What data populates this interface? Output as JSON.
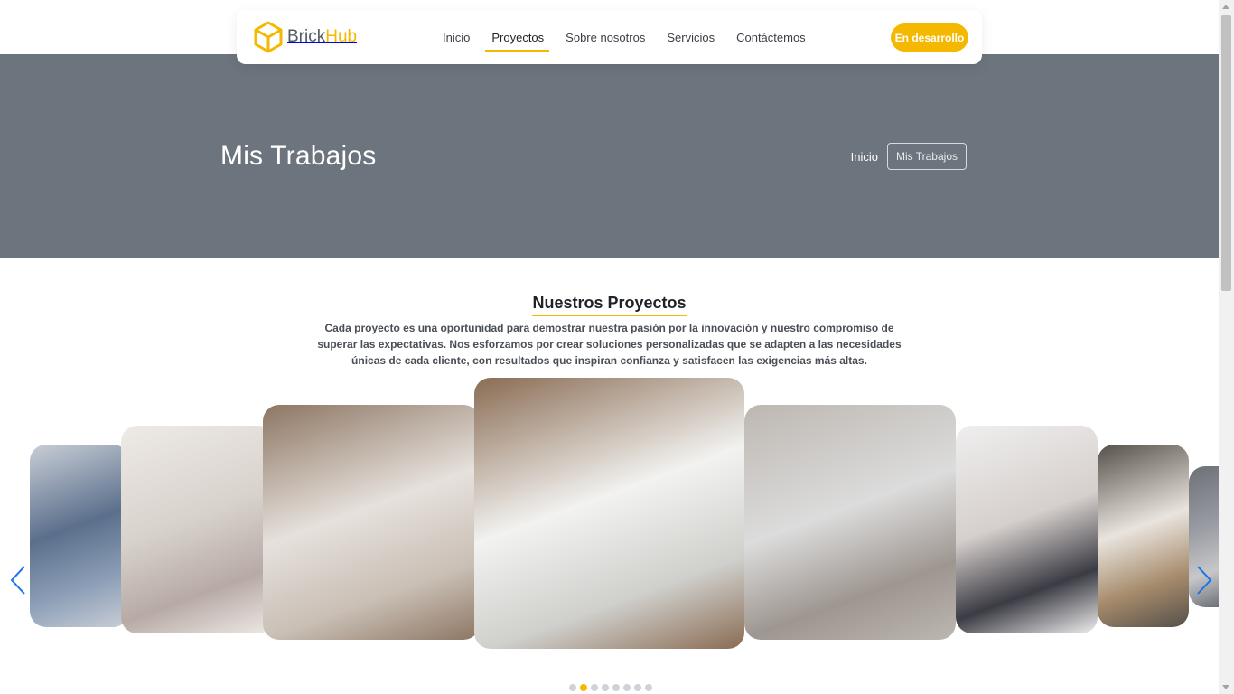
{
  "brand": {
    "name_part1": "Brick",
    "name_part2": "Hub"
  },
  "nav": {
    "items": [
      {
        "label": "Inicio"
      },
      {
        "label": "Proyectos",
        "active": true
      },
      {
        "label": "Sobre nosotros"
      },
      {
        "label": "Servicios"
      },
      {
        "label": "Contáctemos"
      }
    ],
    "cta_label": "En desarrollo"
  },
  "hero": {
    "title": "Mis Trabajos",
    "breadcrumb": {
      "home": "Inicio",
      "current": "Mis Trabajos"
    }
  },
  "section": {
    "title": "Nuestros Proyectos",
    "description": "Cada proyecto es una oportunidad para demostrar nuestra pasión por la innovación y nuestro compromiso de superar las expectativas. Nos esforzamos por crear soluciones personalizadas que se adapten a las necesidades únicas de cada cliente, con resultados que inspiran confianza y satisfacen las exigencias más altas."
  },
  "carousel": {
    "slides": [
      {
        "name": "mosaic-tile-wall",
        "colors": [
          "#5b6f8c",
          "#8ea0b8",
          "#c9ced6"
        ]
      },
      {
        "name": "unfinished-bathroom",
        "colors": [
          "#d8d2cc",
          "#b7aaa6",
          "#eeeae6"
        ]
      },
      {
        "name": "bathroom-radiator",
        "colors": [
          "#e6e1dc",
          "#c9bfb5",
          "#8d7663"
        ]
      },
      {
        "name": "marble-bathroom",
        "colors": [
          "#f2f2f0",
          "#cfcfcc",
          "#8a6c53"
        ]
      },
      {
        "name": "grey-kitchen",
        "colors": [
          "#dcdcdc",
          "#9e9690",
          "#bdb7b1"
        ]
      },
      {
        "name": "sink-vanity",
        "colors": [
          "#d6cfcc",
          "#3b3b44",
          "#efefef"
        ]
      },
      {
        "name": "wood-kitchen",
        "colors": [
          "#e9e4de",
          "#a58a6a",
          "#55504a"
        ]
      },
      {
        "name": "terrazzo-edge",
        "colors": [
          "#9a9da3",
          "#c6c7ca",
          "#6d7177"
        ]
      }
    ],
    "active_index": 1,
    "dot_count": 8,
    "accent": "#f5b800",
    "arrow_color": "#1a73e8"
  }
}
